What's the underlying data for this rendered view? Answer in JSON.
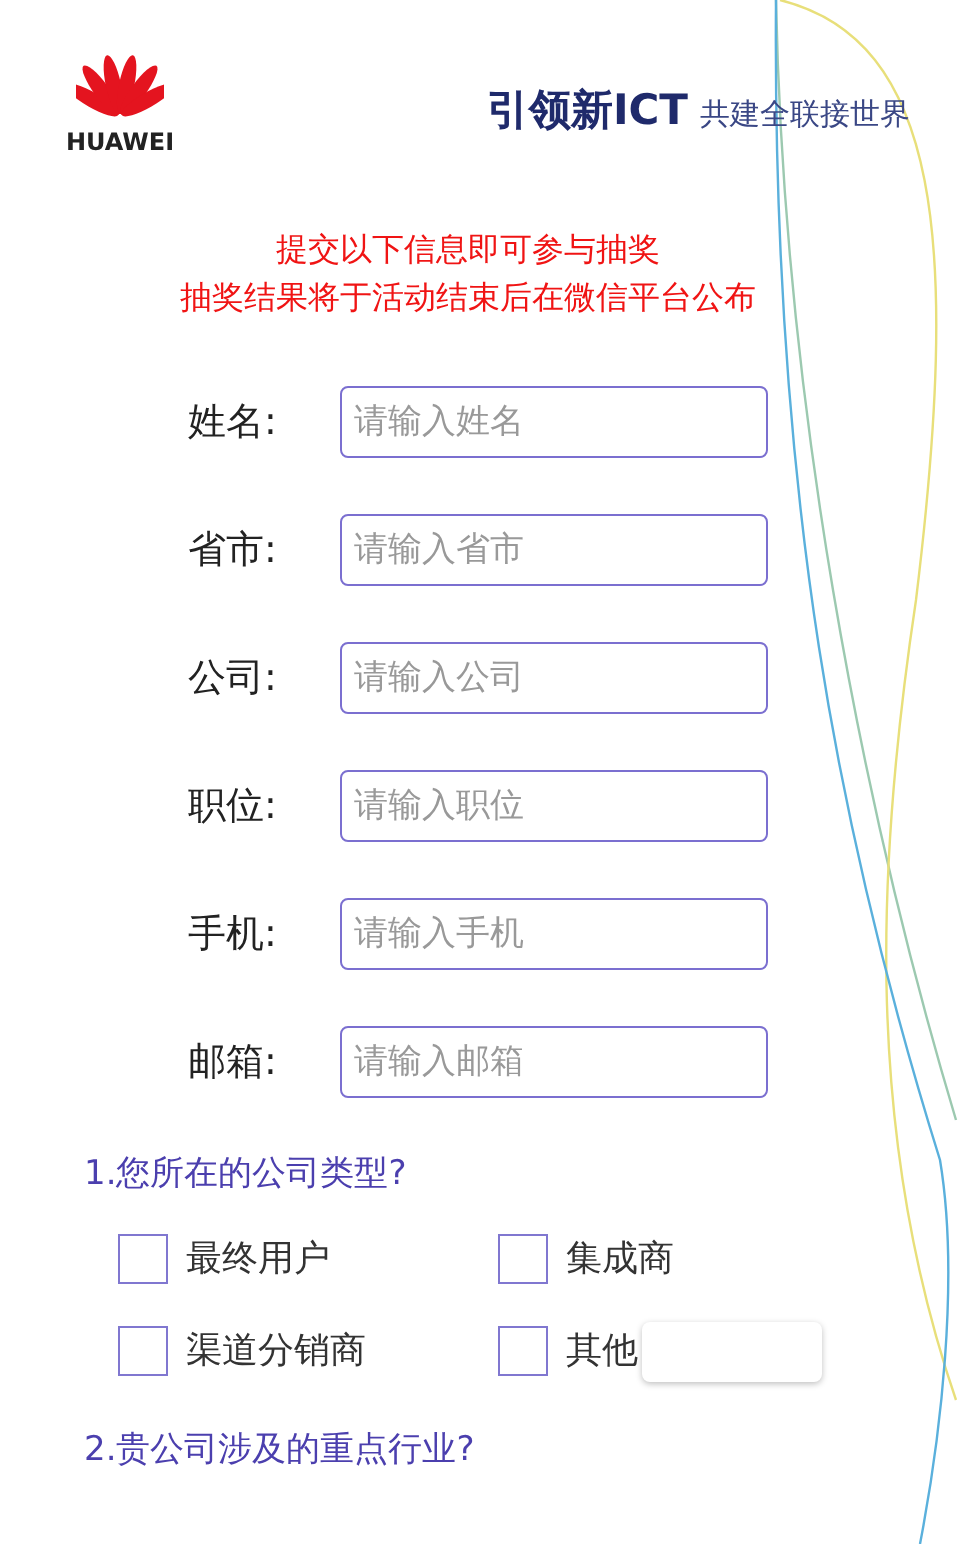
{
  "header": {
    "logo_text": "HUAWEI",
    "slogan_main": "引领新ICT",
    "slogan_sub": "共建全联接世界"
  },
  "notice": [
    "提交以下信息即可参与抽奖",
    "抽奖结果将于活动结束后在微信平台公布"
  ],
  "fields": [
    {
      "label": "姓名:",
      "placeholder": "请输入姓名"
    },
    {
      "label": "省市:",
      "placeholder": "请输入省市"
    },
    {
      "label": "公司:",
      "placeholder": "请输入公司"
    },
    {
      "label": "职位:",
      "placeholder": "请输入职位"
    },
    {
      "label": "手机:",
      "placeholder": "请输入手机"
    },
    {
      "label": "邮箱:",
      "placeholder": "请输入邮箱"
    }
  ],
  "questions": [
    {
      "title": "1.您所在的公司类型?",
      "options": [
        {
          "label": "最终用户",
          "checked": false,
          "kind": "checkbox"
        },
        {
          "label": "集成商",
          "checked": false,
          "kind": "checkbox"
        },
        {
          "label": "渠道分销商",
          "checked": false,
          "kind": "checkbox"
        },
        {
          "label": "其他",
          "checked": false,
          "kind": "other"
        }
      ]
    },
    {
      "title": "2.贵公司涉及的重点行业?"
    }
  ]
}
